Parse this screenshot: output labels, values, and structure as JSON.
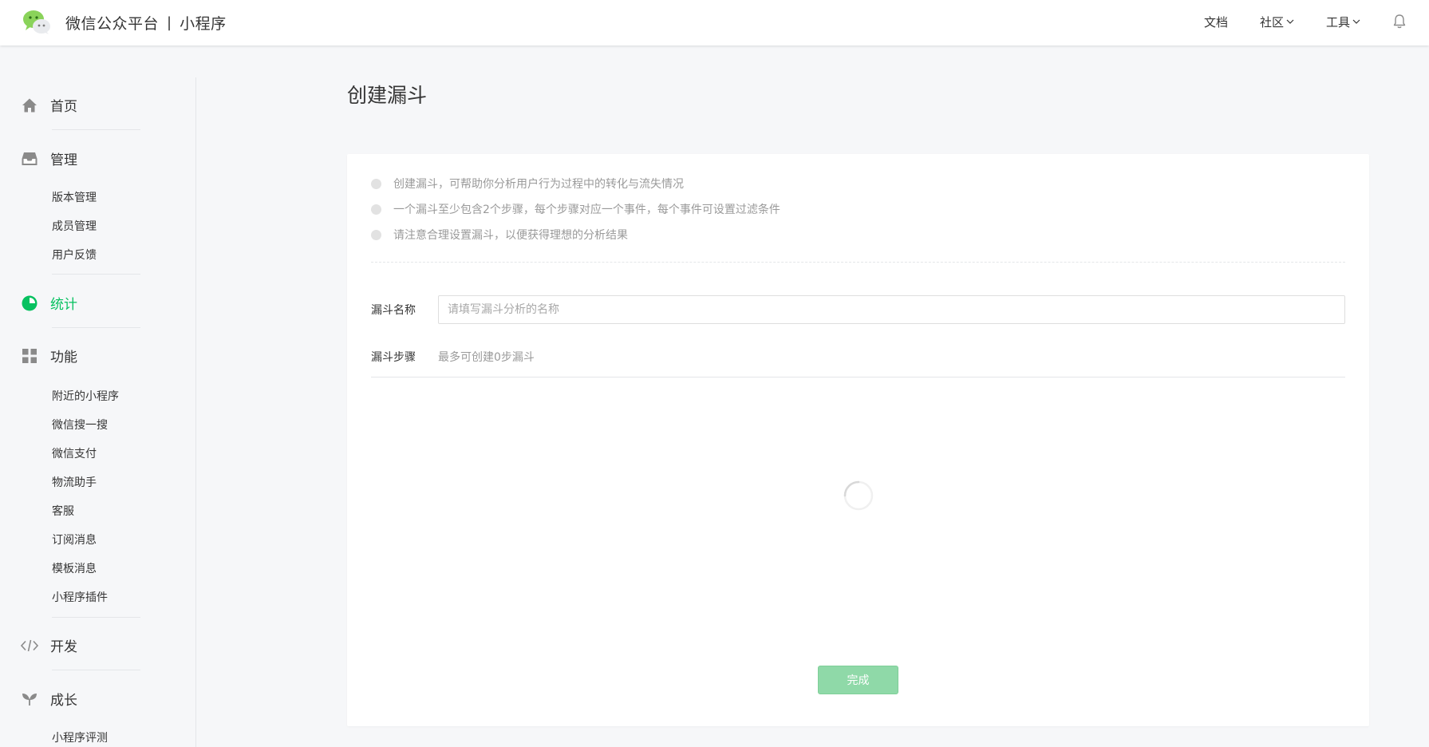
{
  "header": {
    "platform_name": "微信公众平台",
    "separator": "|",
    "product_name": "小程序",
    "nav": {
      "docs": "文档",
      "community": "社区",
      "tools": "工具"
    }
  },
  "sidebar": {
    "home": "首页",
    "manage": {
      "label": "管理",
      "items": [
        "版本管理",
        "成员管理",
        "用户反馈"
      ]
    },
    "stats": "统计",
    "features": {
      "label": "功能",
      "items": [
        "附近的小程序",
        "微信搜一搜",
        "微信支付",
        "物流助手",
        "客服",
        "订阅消息",
        "模板消息",
        "小程序插件"
      ]
    },
    "develop": "开发",
    "growth": {
      "label": "成长",
      "items": [
        "小程序评测"
      ]
    }
  },
  "main": {
    "title": "创建漏斗",
    "tips": [
      "创建漏斗，可帮助你分析用户行为过程中的转化与流失情况",
      "一个漏斗至少包含2个步骤，每个步骤对应一个事件，每个事件可设置过滤条件",
      "请注意合理设置漏斗，以便获得理想的分析结果"
    ],
    "funnel_name_label": "漏斗名称",
    "funnel_name_value": "",
    "funnel_name_placeholder": "请填写漏斗分析的名称",
    "funnel_steps_label": "漏斗步骤",
    "funnel_steps_hint": "最多可创建0步漏斗",
    "submit_label": "完成"
  },
  "colors": {
    "accent": "#07c160",
    "button_disabled": "#8fd9a8",
    "page_bg": "#f6f7f9"
  },
  "icons": {
    "logo": "wechat-logo-icon",
    "home": "house-icon",
    "manage": "inbox-icon",
    "stats": "pie-chart-icon",
    "features": "grid-icon",
    "develop": "code-icon",
    "growth": "sprout-icon",
    "bell": "bell-icon",
    "chevron": "chevron-down-icon",
    "loading": "spinner-icon"
  }
}
